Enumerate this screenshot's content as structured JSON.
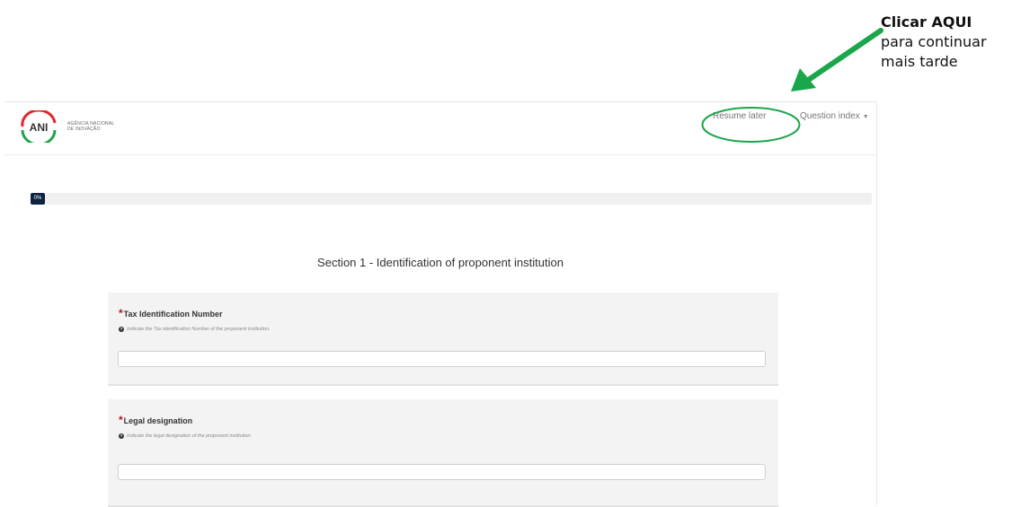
{
  "annotation": {
    "title": "Clicar AQUI",
    "line1": "para continuar",
    "line2": "mais tarde",
    "arrow_color": "#1aa64a",
    "circle_color": "#1aa64a"
  },
  "header": {
    "logo_mark": "ANI",
    "logo_line1": "AGÊNCIA NACIONAL",
    "logo_line2": "DE INOVAÇÃO",
    "resume_later": "Resume later",
    "question_index": "Question index",
    "dropdown_icon": "caret-down-icon"
  },
  "progress": {
    "label": "0%",
    "value": 0,
    "fill_color": "#0d2342"
  },
  "section": {
    "title": "Section 1 - Identification of proponent institution"
  },
  "questions": [
    {
      "required_mark": "*",
      "label": "Tax Identification Number",
      "help": "Indicate the Tax identification Number of the proponent institution.",
      "value": ""
    },
    {
      "required_mark": "*",
      "label": "Legal designation",
      "help": "Indicate the legal designation of the proponent institution.",
      "value": ""
    }
  ]
}
